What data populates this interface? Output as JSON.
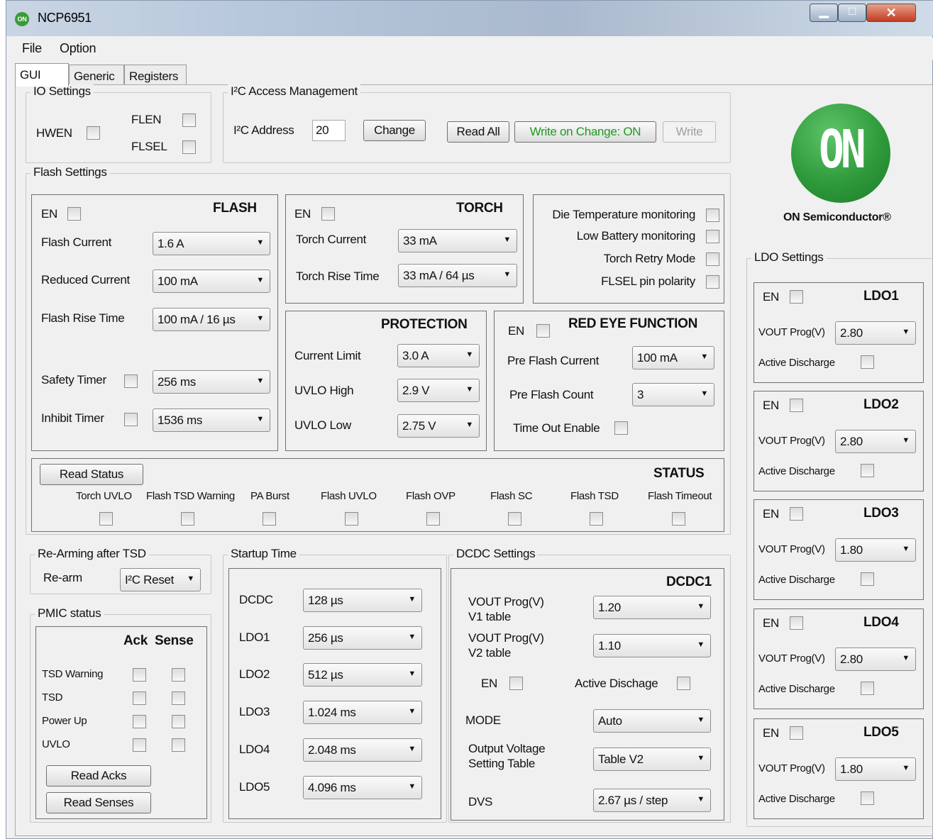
{
  "window": {
    "title": "NCP6951",
    "app_icon": "ON"
  },
  "menu": {
    "file": "File",
    "option": "Option"
  },
  "tabs": [
    "GUI",
    "Generic",
    "Registers"
  ],
  "io": {
    "title": "IO Settings",
    "hwen": "HWEN",
    "flen": "FLEN",
    "flsel": "FLSEL"
  },
  "i2c": {
    "title": "I²C Access Management",
    "address_label": "I²C  Address",
    "address_value": "20",
    "change": "Change",
    "read_all": "Read All",
    "write_on_change": "Write on Change: ON",
    "write": "Write",
    "write_on_change_color": "#1f9a1f"
  },
  "logo": {
    "text": "ON",
    "caption": "ON Semiconductor®",
    "color": "#2e9a3a"
  },
  "flash_settings": {
    "title": "Flash Settings"
  },
  "flash": {
    "title": "FLASH",
    "en": "EN",
    "flash_current_label": "Flash Current",
    "flash_current": "1.6 A",
    "reduced_current_label": "Reduced Current",
    "reduced_current": "100 mA",
    "rise_time_label": "Flash Rise Time",
    "rise_time": "100 mA / 16 µs",
    "safety_label": "Safety Timer",
    "safety": "256 ms",
    "inhibit_label": "Inhibit Timer",
    "inhibit": "1536 ms"
  },
  "torch": {
    "title": "TORCH",
    "en": "EN",
    "current_label": "Torch Current",
    "current": "33 mA",
    "rise_label": "Torch Rise Time",
    "rise": "33 mA / 64 µs"
  },
  "monitor": {
    "die_temp": "Die Temperature monitoring",
    "low_batt": "Low Battery monitoring",
    "torch_retry": "Torch Retry Mode",
    "flsel_pol": "FLSEL pin polarity"
  },
  "protection": {
    "title": "PROTECTION",
    "current_limit_label": "Current Limit",
    "current_limit": "3.0 A",
    "uvlo_high_label": "UVLO High",
    "uvlo_high": "2.9 V",
    "uvlo_low_label": "UVLO Low",
    "uvlo_low": "2.75 V"
  },
  "redeye": {
    "title": "RED EYE FUNCTION",
    "en": "EN",
    "pre_current_label": "Pre Flash Current",
    "pre_current": "100 mA",
    "pre_count_label": "Pre Flash Count",
    "pre_count": "3",
    "timeout_label": "Time Out Enable"
  },
  "status": {
    "title": "STATUS",
    "read": "Read Status",
    "items": [
      "Torch UVLO",
      "Flash TSD Warning",
      "PA Burst",
      "Flash UVLO",
      "Flash OVP",
      "Flash SC",
      "Flash TSD",
      "Flash Timeout"
    ]
  },
  "rearm": {
    "title": "Re-Arming after TSD",
    "label": "Re-arm",
    "value": "I²C Reset"
  },
  "pmic": {
    "title": "PMIC status",
    "ack": "Ack",
    "sense": "Sense",
    "rows": [
      "TSD Warning",
      "TSD",
      "Power Up",
      "UVLO"
    ],
    "read_acks": "Read Acks",
    "read_senses": "Read Senses"
  },
  "startup": {
    "title": "Startup Time",
    "rows": [
      {
        "label": "DCDC",
        "value": "128 µs"
      },
      {
        "label": "LDO1",
        "value": "256 µs"
      },
      {
        "label": "LDO2",
        "value": "512 µs"
      },
      {
        "label": "LDO3",
        "value": "1.024 ms"
      },
      {
        "label": "LDO4",
        "value": "2.048 ms"
      },
      {
        "label": "LDO5",
        "value": "4.096 ms"
      }
    ]
  },
  "dcdc": {
    "title": "DCDC Settings",
    "name": "DCDC1",
    "v1_label_a": "VOUT Prog(V)",
    "v1_label_b": "V1 table",
    "v1": "1.20",
    "v2_label_a": "VOUT Prog(V)",
    "v2_label_b": "V2 table",
    "v2": "1.10",
    "en": "EN",
    "active_discharge": "Active Dischage",
    "mode_label": "MODE",
    "mode": "Auto",
    "ovst_a": "Output Voltage",
    "ovst_b": "Setting Table",
    "ovst": "Table V2",
    "dvs_label": "DVS",
    "dvs": "2.67 µs / step"
  },
  "ldo": {
    "title": "LDO Settings",
    "en": "EN",
    "vout": "VOUT Prog(V)",
    "ad": "Active Discharge",
    "items": [
      {
        "name": "LDO1",
        "value": "2.80"
      },
      {
        "name": "LDO2",
        "value": "2.80"
      },
      {
        "name": "LDO3",
        "value": "1.80"
      },
      {
        "name": "LDO4",
        "value": "2.80"
      },
      {
        "name": "LDO5",
        "value": "1.80"
      }
    ]
  }
}
